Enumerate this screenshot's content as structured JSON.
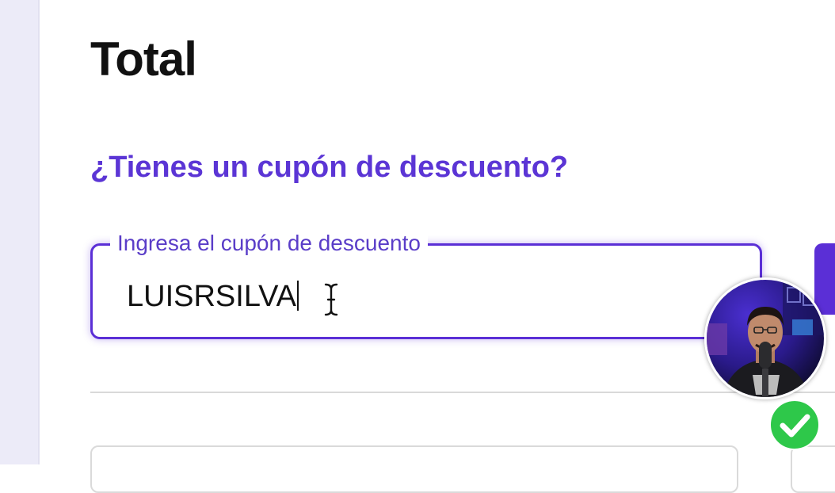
{
  "summary": {
    "title": "Total"
  },
  "coupon": {
    "question": "¿Tienes un cupón de descuento?",
    "input_label": "Ingresa el cupón de descuento",
    "input_value": "LUISRSILVA"
  },
  "colors": {
    "accent": "#5b2fd6",
    "heading_accent": "#5b35d5",
    "text": "#111111",
    "success": "#2ec84a"
  },
  "icons": {
    "cursor": "i-beam-cursor-icon",
    "status": "checkmark-circle-icon"
  }
}
